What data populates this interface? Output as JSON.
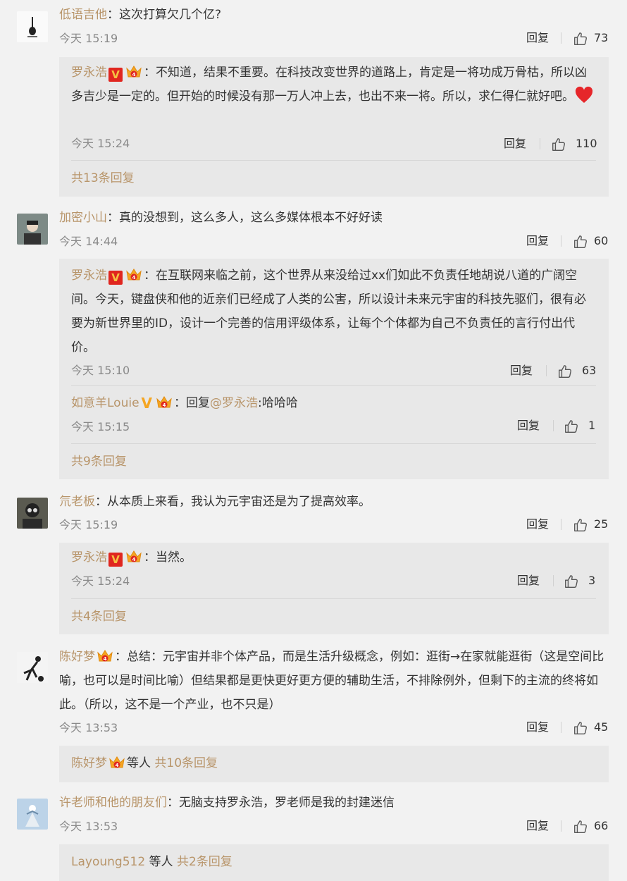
{
  "reply_label": "回复",
  "colon": "：",
  "comments": [
    {
      "user": "低语吉他",
      "text": "这次打算欠几个亿?",
      "time": "今天 15:19",
      "likes": "73",
      "replies": [
        {
          "user": "罗永浩",
          "text": "不知道，结果不重要。在科技改变世界的道路上，肯定是一将功成万骨枯，所以凶多吉少是一定的。但开始的时候没有那一万人冲上去，也出不来一将。所以，求仁得仁就好吧。",
          "time": "今天 15:24",
          "likes": "110"
        }
      ],
      "more": "共13条回复"
    },
    {
      "user": "加密小山",
      "text": "真的没想到，这么多人，这么多媒体根本不好好读",
      "time": "今天 14:44",
      "likes": "60",
      "replies": [
        {
          "user": "罗永浩",
          "text": "在互联网来临之前，这个世界从来没给过xx们如此不负责任地胡说八道的广阔空间。今天，键盘侠和他的近亲们已经成了人类的公害，所以设计未来元宇宙的科技先驱们，很有必要为新世界里的ID，设计一个完善的信用评级体系，让每个个体都为自己不负责任的言行付出代价。",
          "time": "今天 15:10",
          "likes": "63"
        },
        {
          "user": "如意羊Louie",
          "reply_prefix": "回复",
          "mention": "@罗永浩",
          "text": ":哈哈哈",
          "time": "今天 15:15",
          "likes": "1"
        }
      ],
      "more": "共9条回复"
    },
    {
      "user": "氘老板",
      "text": "从本质上来看，我认为元宇宙还是为了提高效率。",
      "time": "今天 15:19",
      "likes": "25",
      "replies": [
        {
          "user": "罗永浩",
          "text": "当然。",
          "time": "今天 15:24",
          "likes": "3"
        }
      ],
      "more": "共4条回复"
    },
    {
      "user": "陈好梦",
      "text": "总结：元宇宙并非个体产品，而是生活升级概念，例如：逛街→在家就能逛街（这是空间比喻，也可以是时间比喻）但结果都是更快更好更方便的辅助生活，不排除例外，但剩下的主流的终将如此。（所以，这不是一个产业，也不只是）",
      "time": "今天 13:53",
      "likes": "45",
      "summary_user": "陈好梦",
      "summary_mid": "等人",
      "more": "共10条回复"
    },
    {
      "user": "许老师和他的朋友们",
      "text": "无脑支持罗永浩，罗老师是我的封建迷信",
      "time": "今天 13:53",
      "likes": "66",
      "summary_user": "Layoung512",
      "summary_mid": "等人",
      "more": "共2条回复"
    }
  ],
  "heart_emoji": "❤",
  "badge_v": "V"
}
